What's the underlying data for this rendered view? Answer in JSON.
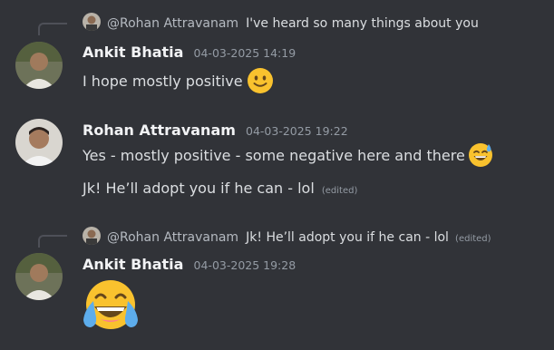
{
  "messages": [
    {
      "reply": {
        "author": "@Rohan Attravanam",
        "text": "I've heard so many things about you"
      },
      "author": "Ankit Bhatia",
      "timestamp": "04-03-2025 14:19",
      "lines": [
        {
          "text": "I hope mostly positive",
          "emoji": "slightly-smiling-face-icon"
        }
      ]
    },
    {
      "author": "Rohan Attravanam",
      "timestamp": "04-03-2025 19:22",
      "lines": [
        {
          "text": "Yes - mostly positive - some negative here and there",
          "emoji": "grinning-sweat-face-icon"
        },
        {
          "text": "Jk! He’ll adopt you if he can - lol",
          "edited": "(edited)"
        }
      ]
    },
    {
      "reply": {
        "author": "@Rohan Attravanam",
        "text": "Jk! He’ll adopt you if he can - lol",
        "edited": "(edited)"
      },
      "author": "Ankit Bhatia",
      "timestamp": "04-03-2025 19:28",
      "lines": [
        {
          "emoji": "face-with-tears-of-joy-icon"
        }
      ]
    }
  ],
  "colors": {
    "background": "#313338",
    "username": "#f2f3f5",
    "text": "#dbdee1",
    "muted": "#949ba4",
    "emoji": "#f9c22e"
  }
}
